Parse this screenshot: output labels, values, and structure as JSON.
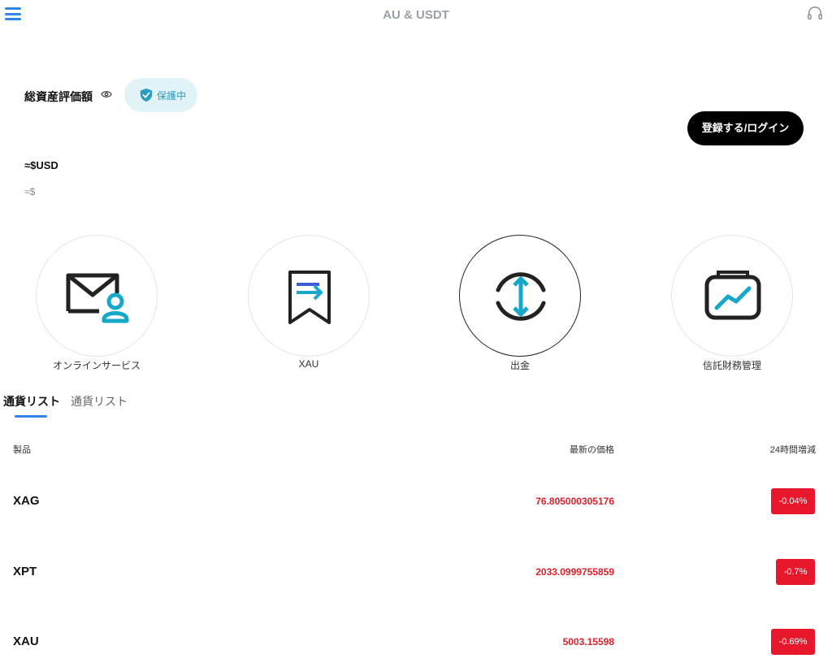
{
  "header": {
    "title": "AU & USDT",
    "menu_icon": "hamburger-icon",
    "support_icon": "headset-icon"
  },
  "assets": {
    "label": "総資産評価額",
    "visibility_icon": "eye-icon",
    "protect_label": "保護中",
    "usd_value": "≈$USD",
    "approx_value": "≈$"
  },
  "login": {
    "label": "登録する/ログイン"
  },
  "quick_actions": [
    {
      "label": "オンラインサービス",
      "icon": "mail-user-icon"
    },
    {
      "label": "XAU",
      "icon": "bookmark-arrow-icon"
    },
    {
      "label": "出金",
      "icon": "exchange-icon"
    },
    {
      "label": "信託財務管理",
      "icon": "chart-folder-icon"
    }
  ],
  "tabs": [
    {
      "label": "通貨リスト"
    },
    {
      "label": "通貨リスト"
    }
  ],
  "table": {
    "headers": {
      "product": "製品",
      "price": "最新の価格",
      "change": "24時間増減"
    },
    "rows": [
      {
        "name": "XAG",
        "price": "76.805000305176",
        "change": "-0.04%"
      },
      {
        "name": "XPT",
        "price": "2033.0999755859",
        "change": "-0.7%"
      },
      {
        "name": "XAU",
        "price": "5003.15598",
        "change": "-0.69%"
      }
    ]
  },
  "colors": {
    "accent": "#2f86e8",
    "negative": "#e8172b",
    "teal": "#17a7c9"
  }
}
